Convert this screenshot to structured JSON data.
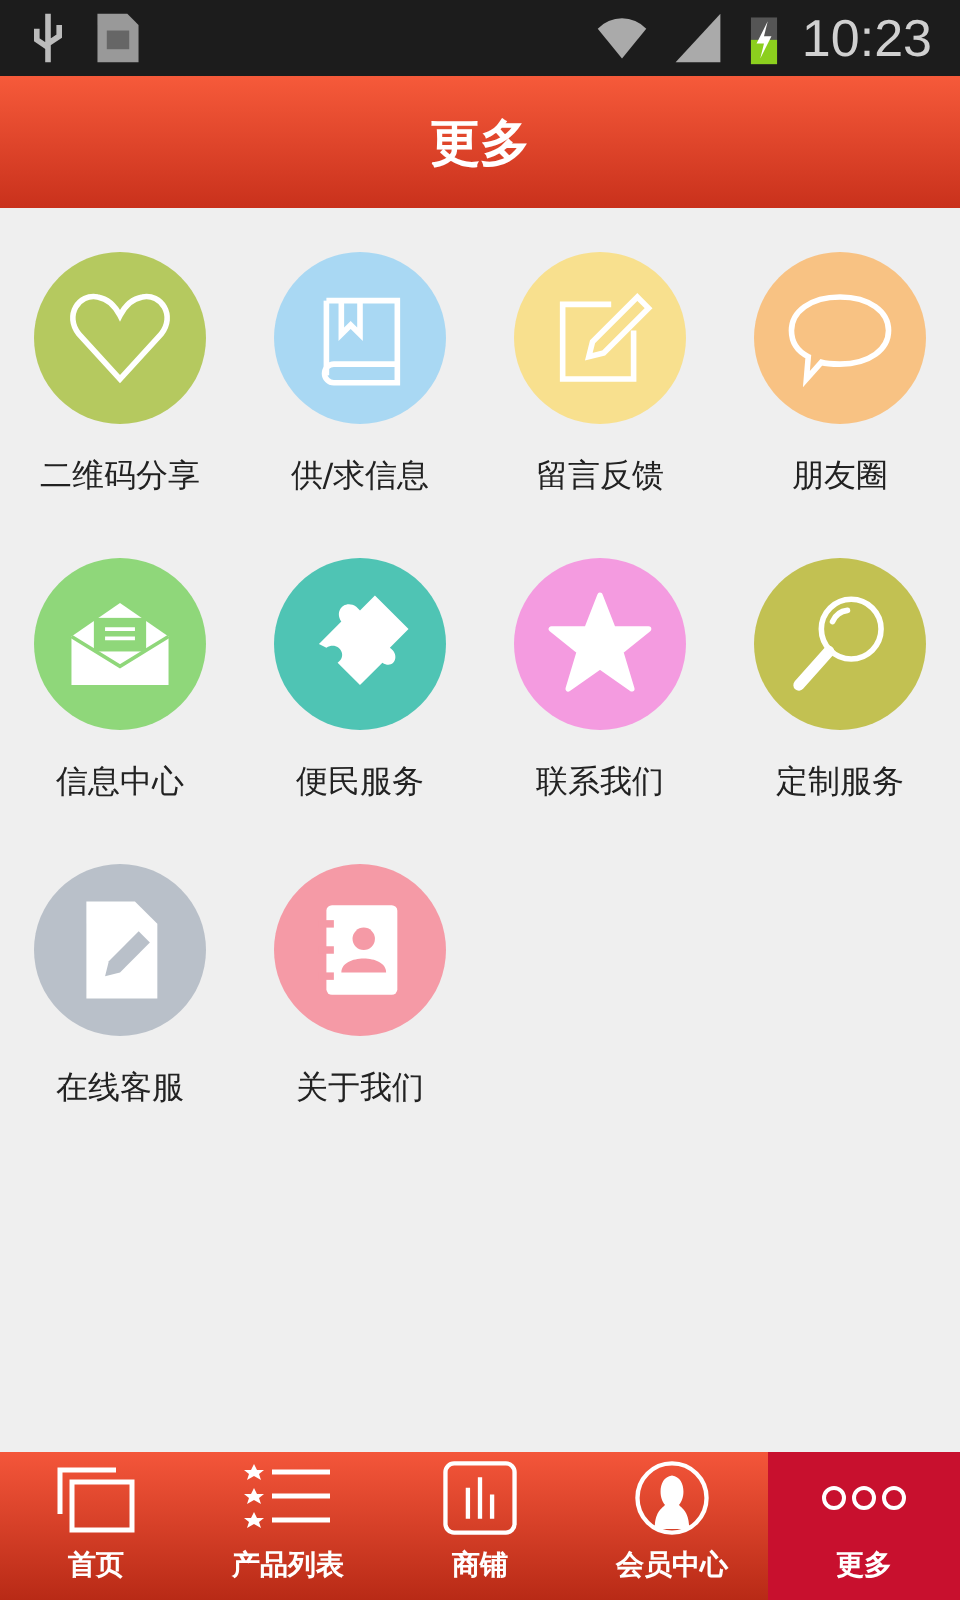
{
  "status_bar": {
    "time": "10:23"
  },
  "header": {
    "title": "更多"
  },
  "grid": [
    {
      "label": "二维码分享",
      "kind": "heart",
      "color": "#b5c95f"
    },
    {
      "label": "供/求信息",
      "kind": "book",
      "color": "#a9d8f3"
    },
    {
      "label": "留言反馈",
      "kind": "note",
      "color": "#f8e08e"
    },
    {
      "label": "朋友圈",
      "kind": "chat",
      "color": "#f8c283"
    },
    {
      "label": "信息中心",
      "kind": "mail",
      "color": "#8fd77a"
    },
    {
      "label": "便民服务",
      "kind": "puzzle",
      "color": "#4fc4b4"
    },
    {
      "label": "联系我们",
      "kind": "star",
      "color": "#f49be0"
    },
    {
      "label": "定制服务",
      "kind": "search",
      "color": "#c2c152"
    },
    {
      "label": "在线客服",
      "kind": "doc",
      "color": "#b9c0c9"
    },
    {
      "label": "关于我们",
      "kind": "contact",
      "color": "#f59aa6"
    }
  ],
  "tab_bar": [
    {
      "label": "首页",
      "kind": "home",
      "selected": false
    },
    {
      "label": "产品列表",
      "kind": "list",
      "selected": false
    },
    {
      "label": "商铺",
      "kind": "shop",
      "selected": false
    },
    {
      "label": "会员中心",
      "kind": "member",
      "selected": false
    },
    {
      "label": "更多",
      "kind": "more",
      "selected": true
    }
  ]
}
